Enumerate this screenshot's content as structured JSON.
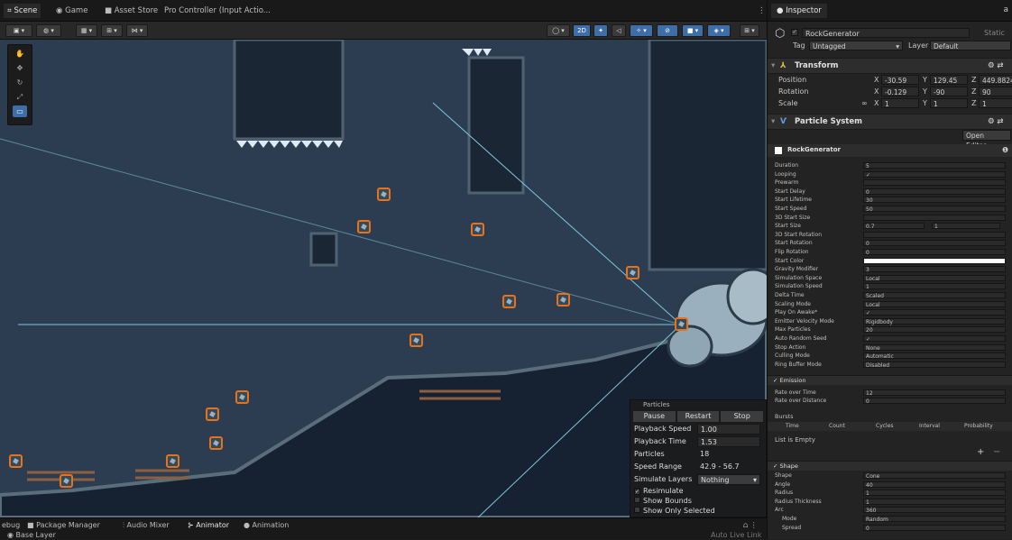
{
  "tabs": {
    "scene": "Scene",
    "game": "Game",
    "asset_store": "Asset Store",
    "pro_controller": "Pro Controller (Input Actio..."
  },
  "toolbar": {
    "mode_2d": "2D"
  },
  "particle_panel": {
    "title": "Particles",
    "pause": "Pause",
    "restart": "Restart",
    "stop": "Stop",
    "playback_speed_label": "Playback Speed",
    "playback_speed": "1.00",
    "playback_time_label": "Playback Time",
    "playback_time": "1.53",
    "particles_label": "Particles",
    "particles": "18",
    "speed_range_label": "Speed Range",
    "speed_range": "42.9 - 56.7",
    "simulate_layers_label": "Simulate Layers",
    "simulate_layers": "Nothing",
    "resimulate": "Resimulate",
    "show_bounds": "Show Bounds",
    "show_only_selected": "Show Only Selected"
  },
  "bottom_tabs": {
    "debug": "ebug",
    "package_manager": "Package Manager",
    "audio_mixer": "Audio Mixer",
    "animator": "Animator",
    "animation": "Animation",
    "base_layer": "Base Layer",
    "auto_live_link": "Auto Live Link"
  },
  "inspector": {
    "tab": "Inspector",
    "object_name": "RockGenerator",
    "static_label": "Static",
    "tag_label": "Tag",
    "tag": "Untagged",
    "layer_label": "Layer",
    "layer": "Default",
    "transform_title": "Transform",
    "position_label": "Position",
    "pos_x": "-30.59",
    "pos_y": "129.45",
    "pos_z": "449.8824",
    "rotation_label": "Rotation",
    "rot_x": "-0.129",
    "rot_y": "-90",
    "rot_z": "90",
    "scale_label": "Scale",
    "scale_x": "1",
    "scale_y": "1",
    "scale_z": "1",
    "particle_system_title": "Particle System",
    "open_editor": "Open Editor...",
    "module_name": "RockGenerator",
    "main_rows": [
      {
        "label": "Duration",
        "value": "5"
      },
      {
        "label": "Looping",
        "value": "✓"
      },
      {
        "label": "Prewarm",
        "value": ""
      },
      {
        "label": "Start Delay",
        "value": "0"
      },
      {
        "label": "Start Lifetime",
        "value": "30"
      },
      {
        "label": "Start Speed",
        "value": "50"
      },
      {
        "label": "3D Start Size",
        "value": ""
      },
      {
        "label": "Start Size",
        "value": "0.7"
      },
      {
        "label": "3D Start Rotation",
        "value": ""
      },
      {
        "label": "Start Rotation",
        "value": "0"
      },
      {
        "label": "Flip Rotation",
        "value": "0"
      },
      {
        "label": "Start Color",
        "value": ""
      },
      {
        "label": "Gravity Modifier",
        "value": "3"
      },
      {
        "label": "Simulation Space",
        "value": "Local"
      },
      {
        "label": "Simulation Speed",
        "value": "1"
      },
      {
        "label": "Delta Time",
        "value": "Scaled"
      },
      {
        "label": "Scaling Mode",
        "value": "Local"
      },
      {
        "label": "Play On Awake*",
        "value": "✓"
      },
      {
        "label": "Emitter Velocity Mode",
        "value": "Rigidbody"
      },
      {
        "label": "Max Particles",
        "value": "20"
      },
      {
        "label": "Auto Random Seed",
        "value": "✓"
      },
      {
        "label": "Stop Action",
        "value": "None"
      },
      {
        "label": "Culling Mode",
        "value": "Automatic"
      },
      {
        "label": "Ring Buffer Mode",
        "value": "Disabled"
      }
    ],
    "start_size_second": "1",
    "emission_title": "Emission",
    "rate_over_time_label": "Rate over Time",
    "rate_over_time": "12",
    "rate_over_distance_label": "Rate over Distance",
    "rate_over_distance": "0",
    "bursts_label": "Bursts",
    "bursts_headers": [
      "Time",
      "Count",
      "Cycles",
      "Interval",
      "Probability"
    ],
    "list_empty": "List is Empty",
    "shape_title": "Shape",
    "shape_rows": [
      {
        "label": "Shape",
        "value": "Cone"
      },
      {
        "label": "Angle",
        "value": "40"
      },
      {
        "label": "Radius",
        "value": "1"
      },
      {
        "label": "Radius Thickness",
        "value": "1"
      },
      {
        "label": "Arc",
        "value": "360"
      },
      {
        "label": "Mode",
        "value": "Random"
      },
      {
        "label": "Spread",
        "value": "0"
      }
    ]
  }
}
